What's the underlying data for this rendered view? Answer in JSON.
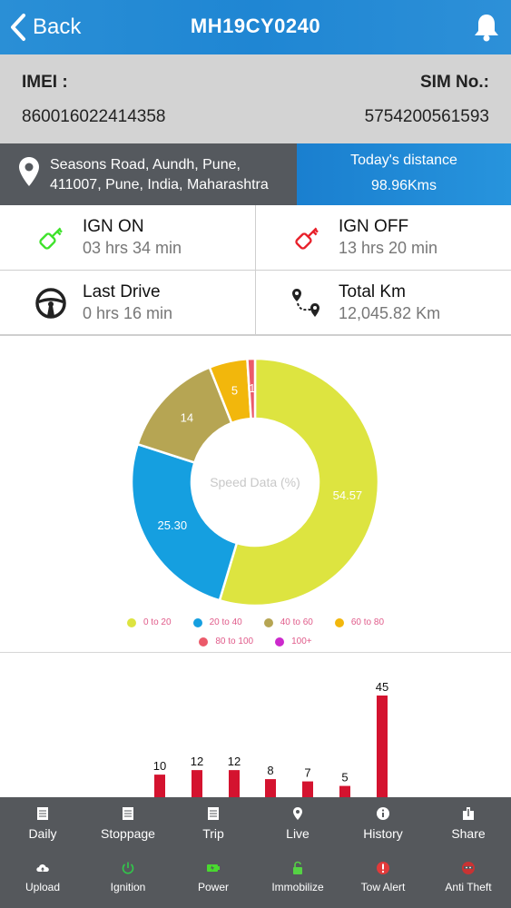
{
  "header": {
    "back_label": "Back",
    "title": "MH19CY0240"
  },
  "device": {
    "imei_label": "IMEI :",
    "imei": "860016022414358",
    "sim_label": "SIM No.:",
    "sim": "5754200561593"
  },
  "location": {
    "address_line1": "Seasons Road, Aundh, Pune,",
    "address_line2": "411007, Pune, India, Maharashtra"
  },
  "distance": {
    "label": "Today's distance",
    "value": "98.96Kms"
  },
  "stats": {
    "ign_on": {
      "label": "IGN ON",
      "value": "03 hrs 34 min"
    },
    "ign_off": {
      "label": "IGN OFF",
      "value": "13 hrs 20 min"
    },
    "last_drive": {
      "label": "Last Drive",
      "value": "0 hrs 16 min"
    },
    "total_km": {
      "label": "Total Km",
      "value": "12,045.82 Km"
    }
  },
  "chart_data": [
    {
      "type": "pie",
      "title": "Speed Data (%)",
      "categories": [
        "0 to 20",
        "20 to 40",
        "40 to 60",
        "60 to 80",
        "80 to 100",
        "100+"
      ],
      "values": [
        54.57,
        25.3,
        14,
        5,
        1,
        0
      ],
      "labels": [
        "54.57",
        "25.30",
        "14",
        "5",
        "1",
        ""
      ],
      "colors": [
        "#dde440",
        "#159fe0",
        "#b6a553",
        "#f2b70c",
        "#eb5a6a",
        "#cc29cc"
      ],
      "legend": "bottom"
    },
    {
      "type": "bar",
      "categories": [
        "",
        "",
        "",
        "",
        "",
        ""
      ],
      "values": [
        10,
        12,
        12,
        8,
        7,
        5,
        45
      ],
      "color": "#d4132f"
    }
  ],
  "nav": {
    "row1": [
      "Daily",
      "Stoppage",
      "Trip",
      "Live",
      "History",
      "Share"
    ],
    "row2": [
      "Upload",
      "Ignition",
      "Power",
      "Immobilize",
      "Tow Alert",
      "Anti Theft"
    ]
  },
  "colors": {
    "header": "#1f86d3",
    "ign_on_icon": "#3ee22b",
    "ign_off_icon": "#e8202a",
    "ignition_icon": "#31c94a",
    "power_icon": "#49d92f",
    "immobilize_icon": "#55d244",
    "tow_alert_icon": "#e23a3a",
    "anti_theft_icon": "#c93333"
  }
}
